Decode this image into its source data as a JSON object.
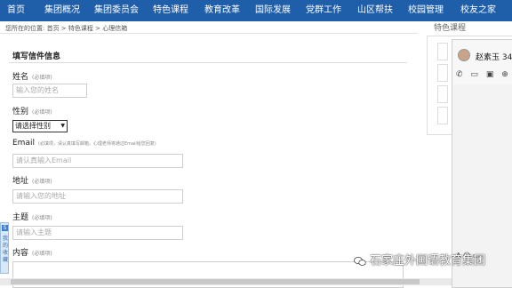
{
  "nav": {
    "items": [
      "首页",
      "集团概况",
      "集团委员会",
      "特色课程",
      "教育改革",
      "国际发展",
      "党群工作",
      "山区帮扶",
      "校园管理",
      "校友之家"
    ],
    "bg_color": "#1f5ea8"
  },
  "breadcrumb": "您所在的位置: 首页 > 特色课程 > 心理信箱",
  "form": {
    "section_title": "填写信件信息",
    "name_label": "姓名",
    "name_req": "(必填项)",
    "name_placeholder": "输入您的姓名",
    "gender_label": "性别",
    "gender_req": "(必填项)",
    "gender_selected": "请选择性别",
    "email_label": "Email",
    "email_hint": "(必填项，请认真填写邮箱，心理老师将通过Email给您回复)",
    "email_placeholder": "请认真输入Email",
    "address_label": "地址",
    "address_req": "(必填项)",
    "address_placeholder": "请输入您的地址",
    "subject_label": "主题",
    "subject_req": "(必填项)",
    "subject_placeholder": "请输入主题",
    "content_label": "内容",
    "content_req": "(必填项)"
  },
  "side_tab": {
    "icon": "S",
    "text": "我的收藏"
  },
  "right_panel": {
    "title": "特色课程"
  },
  "chat": {
    "name": "赵素玉",
    "name_suffix": "34",
    "tools": [
      "phone-icon",
      "video-icon",
      "screen-share-icon",
      "add-icon"
    ],
    "bottom_tools": "A ☺ ▭"
  },
  "watermark": "石家庄外国语教育集团"
}
